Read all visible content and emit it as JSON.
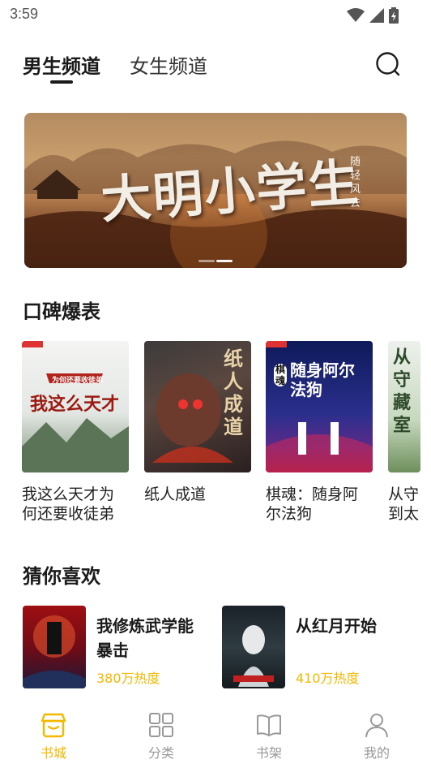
{
  "status_bar": {
    "time": "3:59"
  },
  "tabs": [
    {
      "label": "男生频道",
      "active": true
    },
    {
      "label": "女生频道",
      "active": false
    }
  ],
  "banner": {
    "title": "大明小学生",
    "author": "随轻风去",
    "slide_index": 2,
    "slide_count": 3
  },
  "section_reputation": {
    "title": "口碑爆表",
    "books": [
      {
        "title": "我这么天才为何还要收徒弟",
        "cover_text": "我这么天才",
        "cover_subtext": "为何还要收徒弟"
      },
      {
        "title": "纸人成道",
        "cover_text": "纸人成道"
      },
      {
        "title": "棋魂：随身阿尔法狗",
        "cover_text": "随身阿尔法狗",
        "cover_subtext": "棋魂"
      },
      {
        "title": "从守到太",
        "cover_text": "从守藏室"
      }
    ]
  },
  "section_guess": {
    "title": "猜你喜欢",
    "books": [
      {
        "title": "我修炼武学能暴击",
        "heat": "380万热度"
      },
      {
        "title": "从红月开始",
        "heat": "410万热度"
      }
    ]
  },
  "bottom_nav": [
    {
      "label": "书城",
      "active": true
    },
    {
      "label": "分类",
      "active": false
    },
    {
      "label": "书架",
      "active": false
    },
    {
      "label": "我的",
      "active": false
    }
  ],
  "colors": {
    "accent": "#f5b800",
    "text": "#1a1a1a",
    "muted": "#999999"
  }
}
